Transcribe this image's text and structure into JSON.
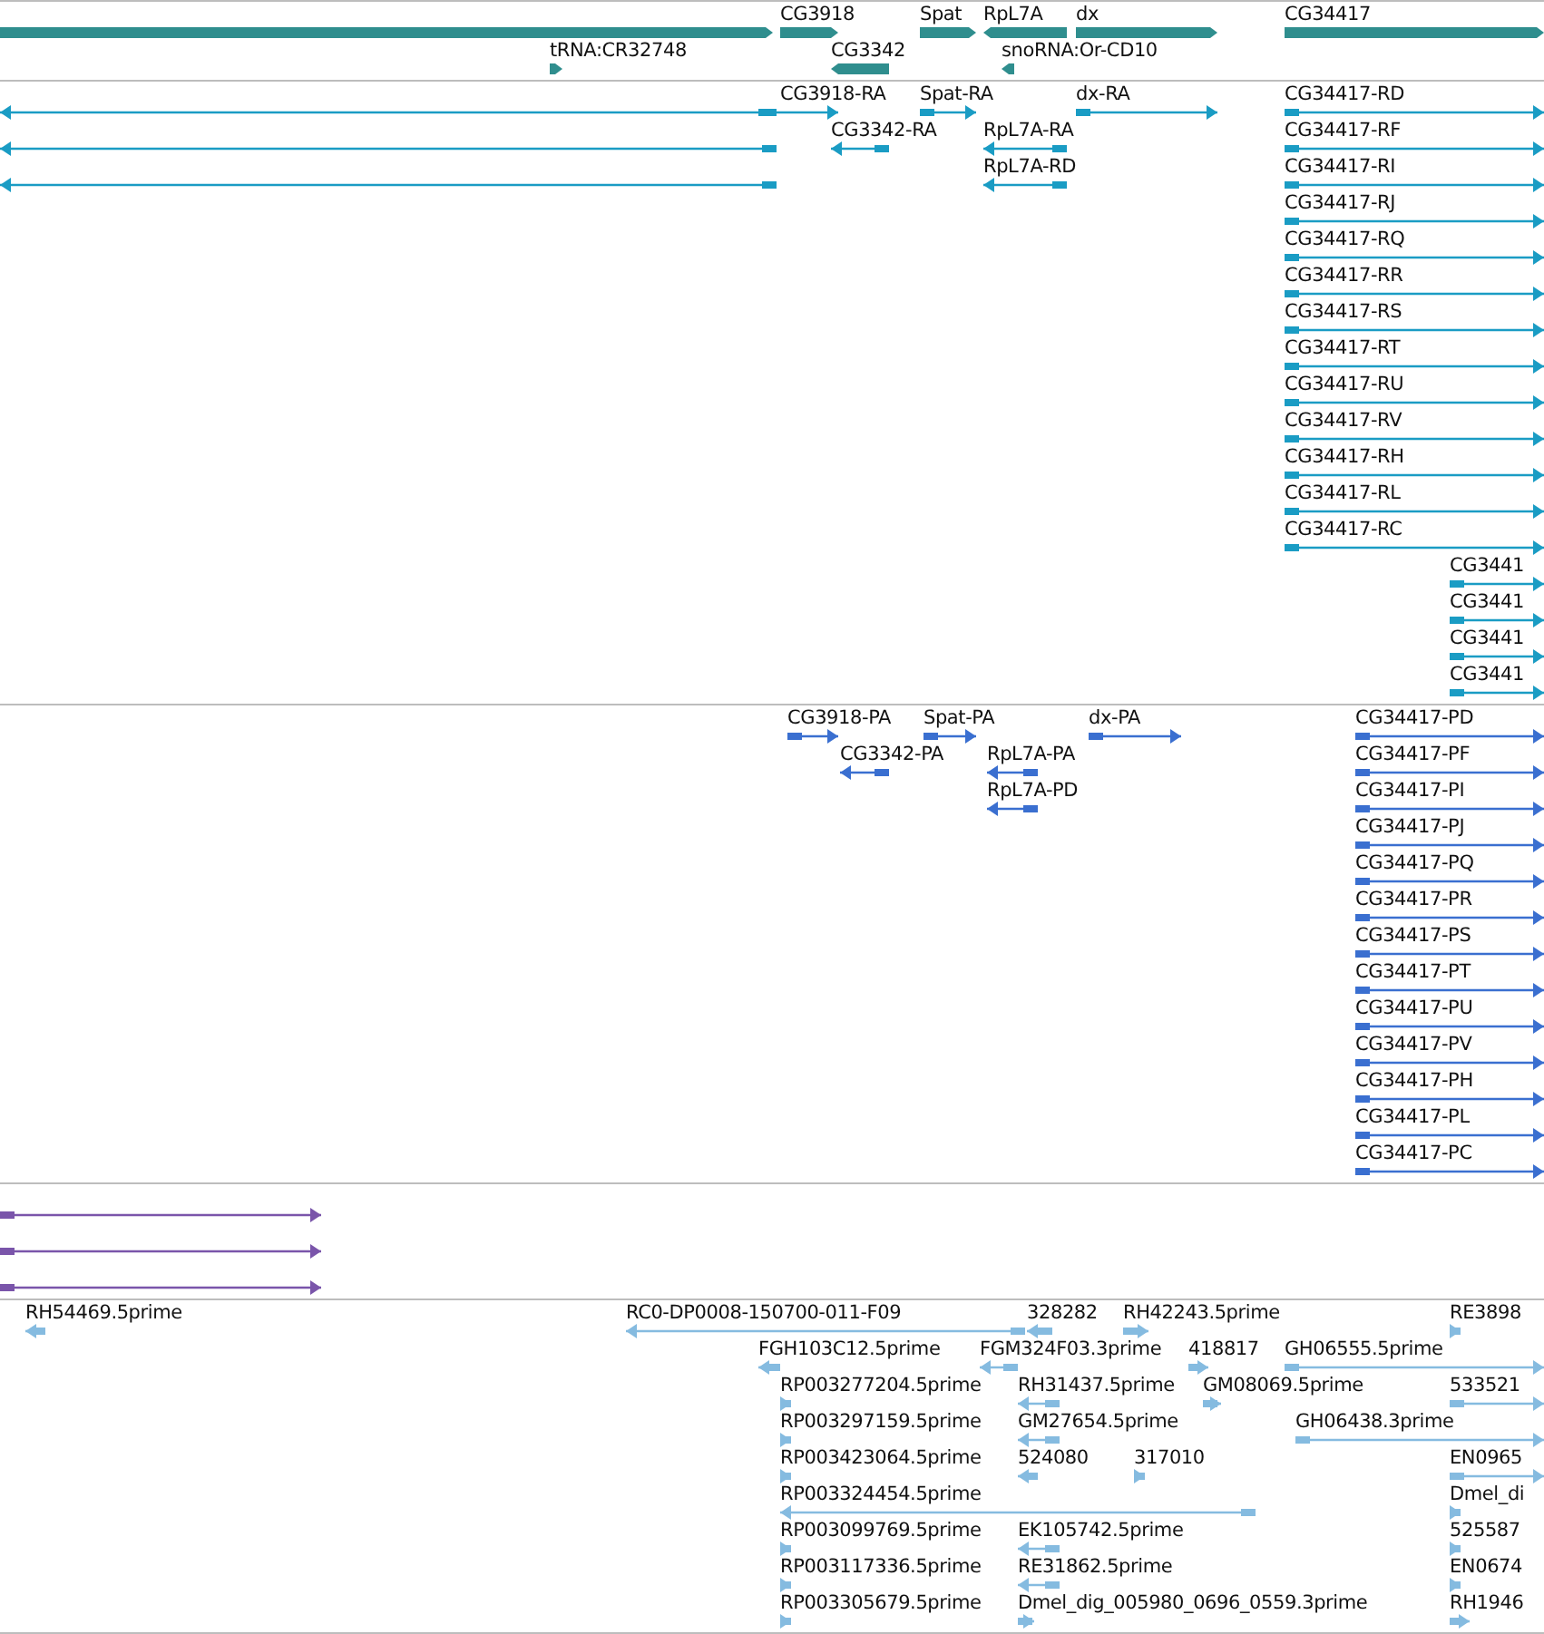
{
  "tracks": [
    {
      "kind": "gene",
      "color": "#2f8e8e",
      "features": [
        {
          "reverse": false
        },
        {
          "label": "CG3918",
          "reverse": false
        },
        {
          "label": "Spat",
          "reverse": false
        },
        {
          "label": "RpL7A",
          "reverse": true
        },
        {
          "label": "dx",
          "reverse": false
        },
        {
          "label": "CG34417",
          "reverse": false
        },
        {
          "label": "tRNA:CR32748",
          "reverse": false
        },
        {
          "label": "CG3342",
          "reverse": true
        },
        {
          "label": "snoRNA:Or-CD10",
          "reverse": true
        }
      ]
    },
    {
      "kind": "transcript",
      "color": "#1a9cc4",
      "features": [
        {
          "reverse": true
        },
        {
          "label": "CG3918-RA",
          "reverse": false
        },
        {
          "label": "Spat-RA",
          "reverse": false
        },
        {
          "label": "dx-RA",
          "reverse": false
        },
        {
          "label": "CG34417-RD",
          "reverse": false
        },
        {
          "reverse": true
        },
        {
          "label": "CG3342-RA",
          "reverse": true
        },
        {
          "label": "RpL7A-RA",
          "reverse": true
        },
        {
          "label": "CG34417-RF",
          "reverse": false
        },
        {
          "reverse": true
        },
        {
          "label": "RpL7A-RD",
          "reverse": true
        },
        {
          "label": "CG34417-RI",
          "reverse": false
        },
        {
          "label": "CG34417-RJ",
          "reverse": false
        },
        {
          "label": "CG34417-RQ",
          "reverse": false
        },
        {
          "label": "CG34417-RR",
          "reverse": false
        },
        {
          "label": "CG34417-RS",
          "reverse": false
        },
        {
          "label": "CG34417-RT",
          "reverse": false
        },
        {
          "label": "CG34417-RU",
          "reverse": false
        },
        {
          "label": "CG34417-RV",
          "reverse": false
        },
        {
          "label": "CG34417-RH",
          "reverse": false
        },
        {
          "label": "CG34417-RL",
          "reverse": false
        },
        {
          "label": "CG34417-RC",
          "reverse": false
        },
        {
          "label": "CG3441",
          "reverse": false
        },
        {
          "label": "CG3441",
          "reverse": false
        },
        {
          "label": "CG3441",
          "reverse": false
        },
        {
          "label": "CG3441",
          "reverse": false
        }
      ]
    },
    {
      "kind": "protein",
      "color": "#3a6fd0",
      "features": [
        {
          "label": "CG3918-PA",
          "reverse": false
        },
        {
          "label": "Spat-PA",
          "reverse": false
        },
        {
          "label": "dx-PA",
          "reverse": false
        },
        {
          "label": "CG34417-PD",
          "reverse": false
        },
        {
          "label": "CG3342-PA",
          "reverse": true
        },
        {
          "label": "RpL7A-PA",
          "reverse": true
        },
        {
          "label": "CG34417-PF",
          "reverse": false
        },
        {
          "label": "RpL7A-PD",
          "reverse": true
        },
        {
          "label": "CG34417-PI",
          "reverse": false
        },
        {
          "label": "CG34417-PJ",
          "reverse": false
        },
        {
          "label": "CG34417-PQ",
          "reverse": false
        },
        {
          "label": "CG34417-PR",
          "reverse": false
        },
        {
          "label": "CG34417-PS",
          "reverse": false
        },
        {
          "label": "CG34417-PT",
          "reverse": false
        },
        {
          "label": "CG34417-PU",
          "reverse": false
        },
        {
          "label": "CG34417-PV",
          "reverse": false
        },
        {
          "label": "CG34417-PH",
          "reverse": false
        },
        {
          "label": "CG34417-PL",
          "reverse": false
        },
        {
          "label": "CG34417-PC",
          "reverse": false
        }
      ]
    },
    {
      "kind": "alignment",
      "color": "#7a55aa",
      "features": [
        {
          "reverse": false
        },
        {
          "reverse": false
        },
        {
          "reverse": false
        }
      ]
    },
    {
      "kind": "est",
      "color": "#85bbe0",
      "features": [
        {
          "label": "RH54469.5prime",
          "reverse": true
        },
        {
          "label": "RC0-DP0008-150700-011-F09",
          "reverse": true
        },
        {
          "label": "328282",
          "reverse": true
        },
        {
          "label": "RH42243.5prime",
          "reverse": false
        },
        {
          "label": "RE3898",
          "reverse": false
        },
        {
          "label": "FGH103C12.5prime",
          "reverse": true
        },
        {
          "label": "FGM324F03.3prime",
          "reverse": true
        },
        {
          "label": "418817",
          "reverse": false
        },
        {
          "label": "GH06555.5prime",
          "reverse": false
        },
        {
          "label": "RP003277204.5prime",
          "reverse": false
        },
        {
          "label": "RH31437.5prime",
          "reverse": true
        },
        {
          "label": "GM08069.5prime",
          "reverse": false
        },
        {
          "label": "533521",
          "reverse": false
        },
        {
          "label": "RP003297159.5prime",
          "reverse": false
        },
        {
          "label": "GM27654.5prime",
          "reverse": true
        },
        {
          "label": "GH06438.3prime",
          "reverse": false
        },
        {
          "label": "RP003423064.5prime",
          "reverse": false
        },
        {
          "label": "524080",
          "reverse": true
        },
        {
          "label": "317010",
          "reverse": false
        },
        {
          "label": "EN0965",
          "reverse": false
        },
        {
          "label": "RP003324454.5prime",
          "reverse": true
        },
        {
          "label": "Dmel_di",
          "reverse": false
        },
        {
          "label": "RP003099769.5prime",
          "reverse": false
        },
        {
          "label": "EK105742.5prime",
          "reverse": true
        },
        {
          "label": "525587",
          "reverse": false
        },
        {
          "label": "RP003117336.5prime",
          "reverse": false
        },
        {
          "label": "RE31862.5prime",
          "reverse": true
        },
        {
          "label": "EN0674",
          "reverse": false
        },
        {
          "label": "RP003305679.5prime",
          "reverse": false
        },
        {
          "label": "Dmel_dig_005980_0696_0559.3prime",
          "reverse": false
        },
        {
          "label": "RH1946",
          "reverse": false
        }
      ]
    }
  ]
}
